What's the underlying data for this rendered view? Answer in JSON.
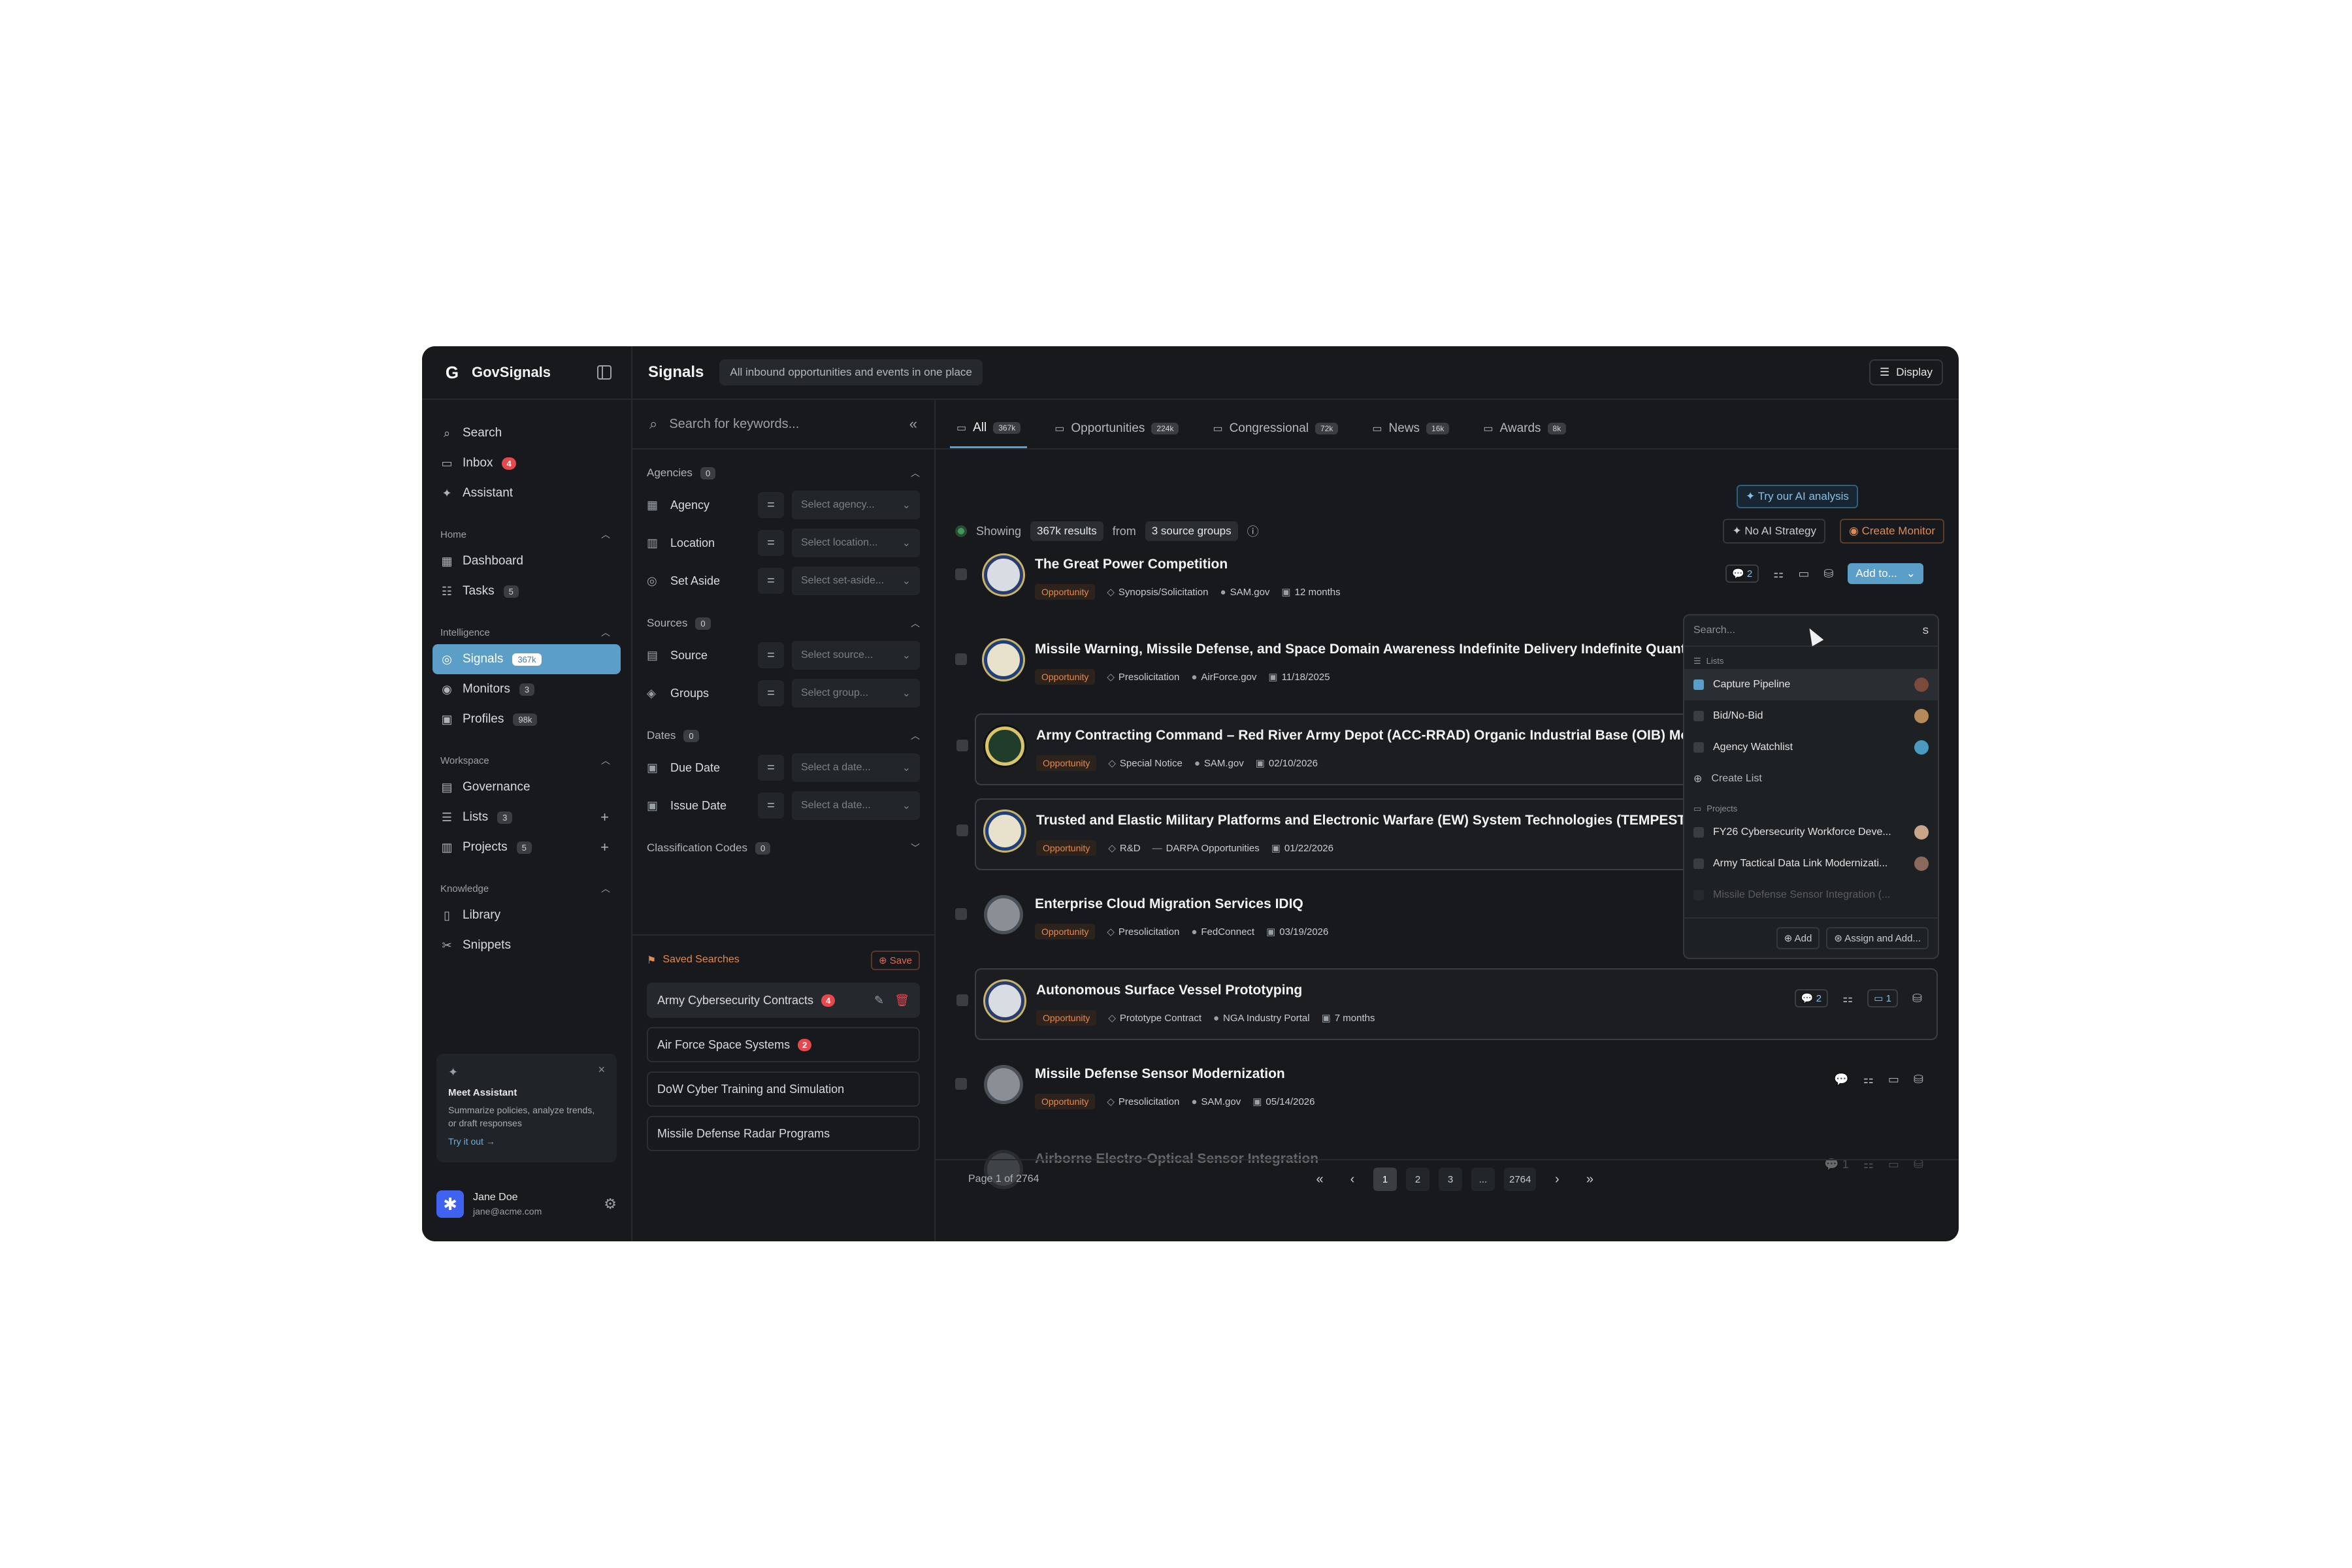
{
  "app": {
    "brand_letter": "G",
    "brand_name": "GovSignals"
  },
  "sidebar": {
    "top": [
      {
        "label": "Search",
        "icon": "search-icon"
      },
      {
        "label": "Inbox",
        "icon": "inbox-icon",
        "badge": "4"
      },
      {
        "label": "Assistant",
        "icon": "sparkle-icon"
      }
    ],
    "sections": [
      {
        "label": "Home",
        "items": [
          {
            "label": "Dashboard",
            "icon": "dashboard-icon"
          },
          {
            "label": "Tasks",
            "icon": "tasks-icon",
            "count": "5"
          }
        ]
      },
      {
        "label": "Intelligence",
        "items": [
          {
            "label": "Signals",
            "icon": "signal-icon",
            "count": "367k",
            "active": true
          },
          {
            "label": "Monitors",
            "icon": "monitor-icon",
            "count": "3"
          },
          {
            "label": "Profiles",
            "icon": "profile-icon",
            "count": "98k"
          }
        ]
      },
      {
        "label": "Workspace",
        "items": [
          {
            "label": "Governance",
            "icon": "governance-icon"
          },
          {
            "label": "Lists",
            "icon": "list-icon",
            "count": "3"
          },
          {
            "label": "Projects",
            "icon": "folder-icon",
            "count": "5"
          }
        ]
      },
      {
        "label": "Knowledge",
        "items": [
          {
            "label": "Library",
            "icon": "library-icon"
          },
          {
            "label": "Snippets",
            "icon": "snippets-icon"
          }
        ]
      }
    ],
    "assistant_card": {
      "title": "Meet Assistant",
      "description": "Summarize policies, analyze trends, or draft responses",
      "link": "Try it out →"
    },
    "user": {
      "name": "Jane Doe",
      "email": "jane@acme.com",
      "avatar": "✱"
    }
  },
  "header": {
    "title": "Signals",
    "subtitle": "All inbound opportunities and events in one place",
    "display_label": "Display"
  },
  "filters": {
    "search_placeholder": "Search for keywords...",
    "groups": [
      {
        "label": "Agencies",
        "count": "0",
        "rows": [
          {
            "label": "Agency",
            "placeholder": "Select agency..."
          },
          {
            "label": "Location",
            "placeholder": "Select location..."
          },
          {
            "label": "Set Aside",
            "placeholder": "Select set-aside..."
          }
        ]
      },
      {
        "label": "Sources",
        "count": "0",
        "rows": [
          {
            "label": "Source",
            "placeholder": "Select source..."
          },
          {
            "label": "Groups",
            "placeholder": "Select group..."
          }
        ]
      },
      {
        "label": "Dates",
        "count": "0",
        "rows": [
          {
            "label": "Due Date",
            "placeholder": "Select a date..."
          },
          {
            "label": "Issue Date",
            "placeholder": "Select a date..."
          }
        ]
      },
      {
        "label": "Classification Codes",
        "count": "0",
        "rows": []
      }
    ],
    "saved": {
      "title": "Saved Searches",
      "save_label": "Save",
      "items": [
        {
          "label": "Army Cybersecurity Contracts",
          "badge": "4"
        },
        {
          "label": "Air Force Space Systems",
          "badge": "2"
        },
        {
          "label": "DoW Cyber Training and Simulation"
        },
        {
          "label": "Missile Defense Radar Programs"
        }
      ]
    }
  },
  "tabs": [
    {
      "label": "All",
      "count": "367k",
      "active": true
    },
    {
      "label": "Opportunities",
      "count": "224k"
    },
    {
      "label": "Congressional",
      "count": "72k"
    },
    {
      "label": "News",
      "count": "16k"
    },
    {
      "label": "Awards",
      "count": "8k"
    }
  ],
  "ai_pill": "Try our AI analysis",
  "summary": {
    "showing": "Showing",
    "results": "367k results",
    "from": "from",
    "groups": "3 source groups",
    "no_ai": "No AI Strategy",
    "create_monitor": "Create Monitor"
  },
  "results": [
    {
      "title": "The Great Power Competition",
      "tag": "Opportunity",
      "type": "Synopsis/Solicitation",
      "source": "SAM.gov",
      "date": "12 months",
      "seal": "navy",
      "comments": "2",
      "add": "Add to..."
    },
    {
      "title": "Missile Warning, Missile Defense, and Space Domain Awareness Indefinite Delivery Indefinite Quantity",
      "tag": "Opportunity",
      "type": "Presolicitation",
      "source": "AirForce.gov",
      "date": "11/18/2025",
      "seal": "af"
    },
    {
      "title": "Army Contracting Command – Red River Army Depot (ACC-RRAD) Organic Industrial Base (OIB) Mode",
      "tag": "Opportunity",
      "type": "Special Notice",
      "source": "SAM.gov",
      "date": "02/10/2026",
      "seal": "army"
    },
    {
      "title": "Trusted and Elastic Military Platforms and Electronic Warfare (EW) System Technologies (TEMPEST)",
      "tag": "Opportunity",
      "type": "R&D",
      "source": "DARPA Opportunities",
      "date": "01/22/2026",
      "seal": "af"
    },
    {
      "title": "Enterprise Cloud Migration Services IDIQ",
      "tag": "Opportunity",
      "type": "Presolicitation",
      "source": "FedConnect",
      "date": "03/19/2026",
      "seal": "grey"
    },
    {
      "title": "Autonomous Surface Vessel Prototyping",
      "tag": "Opportunity",
      "type": "Prototype Contract",
      "source": "NGA Industry Portal",
      "date": "7 months",
      "seal": "navy",
      "comments": "2",
      "projects": "1"
    },
    {
      "title": "Missile Defense Sensor Modernization",
      "tag": "Opportunity",
      "type": "Presolicitation",
      "source": "SAM.gov",
      "date": "05/14/2026",
      "seal": "grey"
    },
    {
      "title": "Airborne Electro-Optical Sensor Integration",
      "tag": "",
      "type": "",
      "source": "",
      "date": "",
      "seal": "grey",
      "comments": "1"
    }
  ],
  "dropdown": {
    "search_placeholder": "Search...",
    "shortcut": "S",
    "lists_label": "Lists",
    "lists": [
      {
        "label": "Capture Pipeline",
        "checked": true
      },
      {
        "label": "Bid/No-Bid"
      },
      {
        "label": "Agency Watchlist"
      }
    ],
    "create_list": "Create List",
    "projects_label": "Projects",
    "projects": [
      {
        "label": "FY26 Cybersecurity Workforce Deve..."
      },
      {
        "label": "Army Tactical Data Link Modernizati..."
      },
      {
        "label": "Missile Defense Sensor Integration (..."
      }
    ],
    "add_label": "Add",
    "assign_label": "Assign and Add..."
  },
  "pager": {
    "info": "Page 1 of 2764",
    "pages": [
      "1",
      "2",
      "3",
      "...",
      "2764"
    ]
  }
}
